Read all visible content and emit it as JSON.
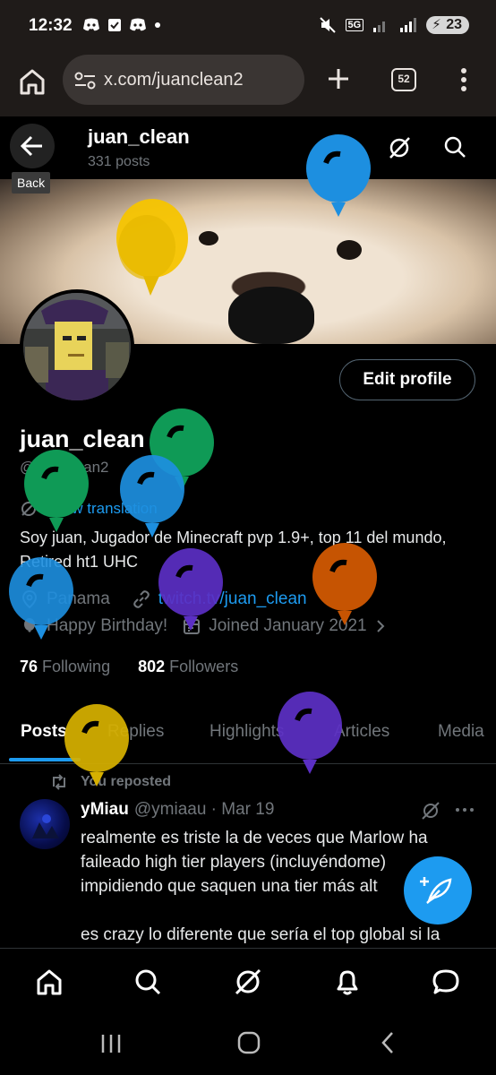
{
  "status_bar": {
    "time": "12:32",
    "network": "5G",
    "battery": "23"
  },
  "browser": {
    "url": "x.com/juanclean2",
    "tab_count": "52"
  },
  "header": {
    "name": "juan_clean",
    "posts": "331 posts",
    "back_tooltip": "Back"
  },
  "profile": {
    "edit_label": "Edit profile",
    "display_name": "juan_clean",
    "handle": "@juanclean2",
    "translate_label": "Show translation",
    "bio": "Soy juan, Jugador de Minecraft pvp 1.9+, top 11 del mundo, Retired ht1 UHC",
    "location": "Panama",
    "link": "twitch.tv/juan_clean",
    "birthday": "Happy Birthday!",
    "joined": "Joined January 2021",
    "following_count": "76",
    "following_label": "Following",
    "followers_count": "802",
    "followers_label": "Followers"
  },
  "tabs": [
    "Posts",
    "Replies",
    "Highlights",
    "Articles",
    "Media"
  ],
  "post": {
    "repost_label": "You reposted",
    "author_name": "yMiau",
    "author_meta": "@ymiaau · Mar 19",
    "lines": [
      "realmente es triste la de veces que Marlow ha",
      "faileado high tier players (incluyéndome)",
      "impidiendo que saquen una tier más alt",
      "",
      "es crazy lo diferente que sería el top global si la"
    ]
  },
  "balloon_colors": {
    "blue": "#1d8fe0",
    "yellow": "#f5c400",
    "green": "#0f9a56",
    "purple": "#5b2fc4",
    "orange": "#c65402",
    "gold": "#d6b000"
  }
}
